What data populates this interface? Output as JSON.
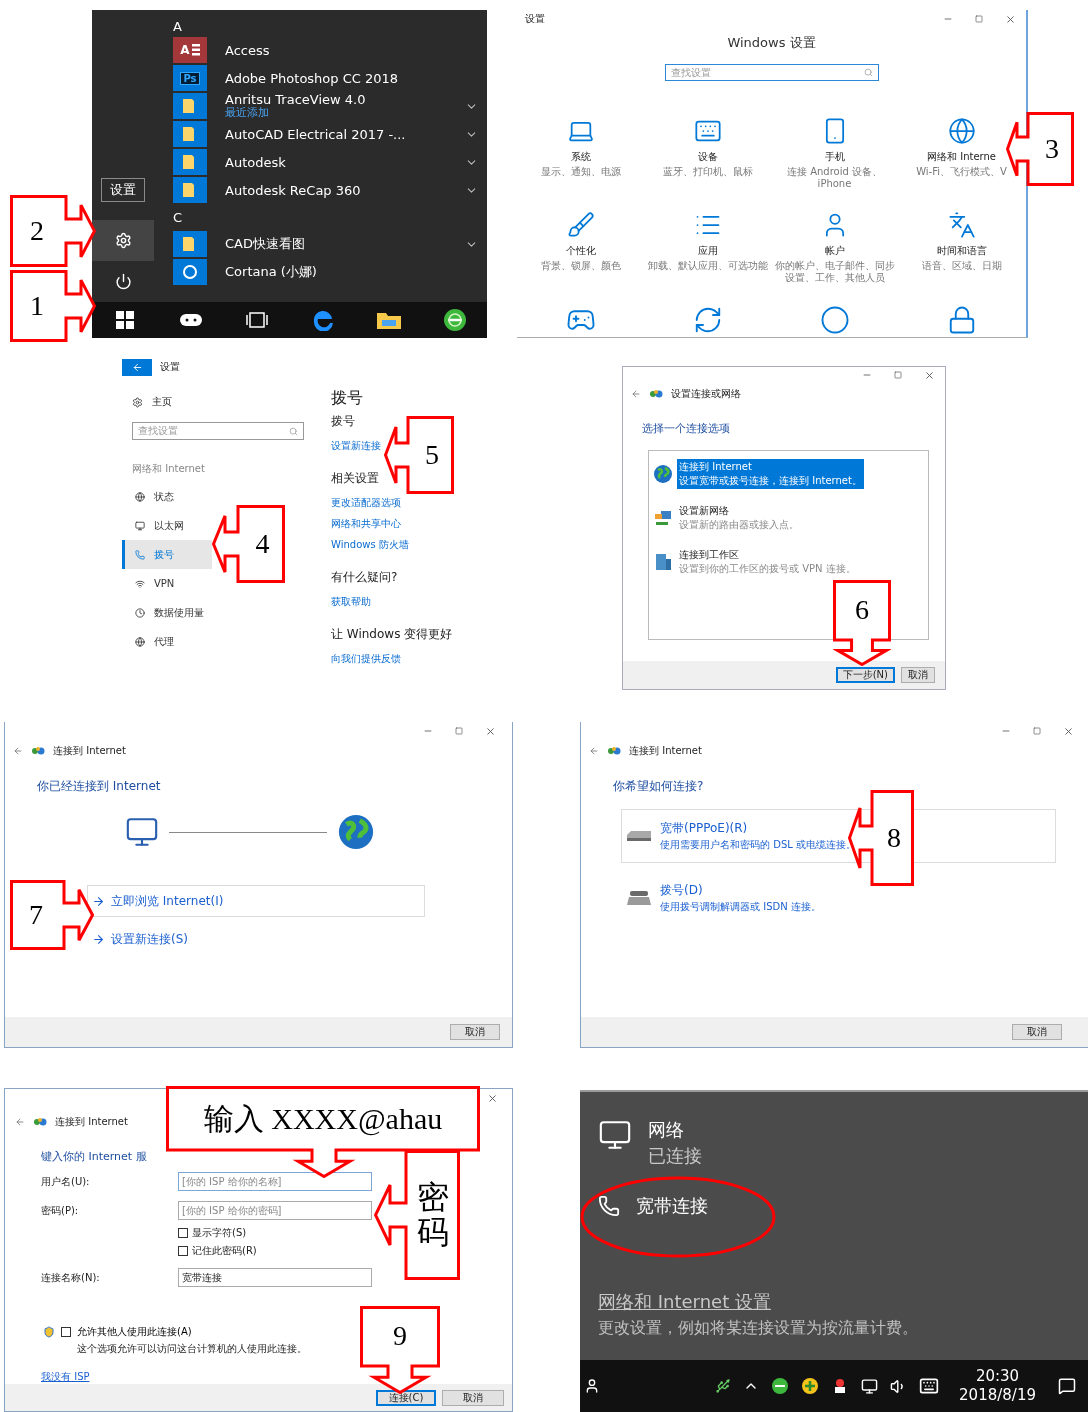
{
  "start_menu": {
    "groups": [
      {
        "letter": "A",
        "apps": [
          {
            "name": "Access",
            "kind": "access",
            "icon_text": "A",
            "expandable": false
          },
          {
            "name": "Adobe Photoshop CC 2018",
            "kind": "photoshop",
            "icon_text": "Ps",
            "expandable": false
          },
          {
            "name": "Anritsu TraceView 4.0",
            "kind": "folder",
            "note": "最近添加",
            "expandable": true
          },
          {
            "name": "AutoCAD Electrical 2017 -...",
            "kind": "folder",
            "expandable": true
          },
          {
            "name": "Autodesk",
            "kind": "folder",
            "expandable": true
          },
          {
            "name": "Autodesk ReCap 360",
            "kind": "folder",
            "expandable": true
          }
        ]
      },
      {
        "letter": "C",
        "apps": [
          {
            "name": "CAD快速看图",
            "kind": "folder",
            "expandable": true
          },
          {
            "name": "Cortana (小娜)",
            "kind": "cortana",
            "expandable": false
          }
        ]
      }
    ],
    "tooltip": "设置",
    "rail": [
      {
        "kind": "settings",
        "selected": true
      },
      {
        "kind": "power",
        "selected": false
      }
    ]
  },
  "windows_settings": {
    "title": "设置",
    "heading": "Windows 设置",
    "search": {
      "placeholder": "查找设置"
    },
    "tiles": [
      {
        "name": "系统",
        "desc": "显示、通知、电源"
      },
      {
        "name": "设备",
        "desc": "蓝牙、打印机、鼠标"
      },
      {
        "name": "手机",
        "desc": "连接 Android 设备、iPhone"
      },
      {
        "name": "网络和 Interne",
        "desc": "Wi-Fi、飞行模式、V"
      },
      {
        "name": "个性化",
        "desc": "背景、锁屏、颜色"
      },
      {
        "name": "应用",
        "desc": "卸载、默认应用、可选功能"
      },
      {
        "name": "帐户",
        "desc": "你的帐户、电子邮件、同步设置、工作、其他人员"
      },
      {
        "name": "时间和语言",
        "desc": "语音、区域、日期"
      }
    ]
  },
  "dialup_settings": {
    "title": "设置",
    "home": "主页",
    "search": {
      "placeholder": "查找设置"
    },
    "section": "网络和 Internet",
    "nav": [
      {
        "label": "状态",
        "selected": false
      },
      {
        "label": "以太网",
        "selected": false
      },
      {
        "label": "拨号",
        "selected": true
      },
      {
        "label": "VPN",
        "selected": false
      },
      {
        "label": "数据使用量",
        "selected": false
      },
      {
        "label": "代理",
        "selected": false
      }
    ],
    "heading": "拨号",
    "groups": [
      {
        "title": "拨号",
        "links": [
          "设置新连接"
        ]
      },
      {
        "title": "相关设置",
        "links": [
          "更改适配器选项",
          "网络和共享中心",
          "Windows 防火墙"
        ]
      },
      {
        "title": "有什么疑问?",
        "links": [
          "获取帮助"
        ]
      },
      {
        "title": "让 Windows 变得更好",
        "links": [
          "向我们提供反馈"
        ]
      }
    ]
  },
  "connection_wizard": {
    "title": "设置连接或网络",
    "heading": "选择一个连接选项",
    "options": [
      {
        "name": "连接到 Internet",
        "desc": "设置宽带或拨号连接，连接到 Internet。",
        "selected": true
      },
      {
        "name": "设置新网络",
        "desc": "设置新的路由器或接入点。",
        "selected": false
      },
      {
        "name": "连接到工作区",
        "desc": "设置到你的工作区的拨号或 VPN 连接。",
        "selected": false
      }
    ],
    "buttons": [
      {
        "label": "下一步(N)",
        "default": true
      },
      {
        "label": "取消",
        "default": false
      }
    ]
  },
  "connected_dialog": {
    "title": "连接到 Internet",
    "heading": "你已经连接到 Internet",
    "actions": [
      {
        "label": "立即浏览 Internet(I)",
        "selected": true
      },
      {
        "label": "设置新连接(S)",
        "selected": false
      }
    ],
    "buttons": [
      "取消"
    ]
  },
  "method_dialog": {
    "title": "连接到 Internet",
    "heading": "你希望如何连接?",
    "options": [
      {
        "name": "宽带(PPPoE)(R)",
        "desc": "使用需要用户名和密码的 DSL 或电缆连接。",
        "selected": true
      },
      {
        "name": "拨号(D)",
        "desc": "使用拨号调制解调器或 ISDN 连接。",
        "selected": false
      }
    ],
    "buttons": [
      "取消"
    ]
  },
  "isp_dialog": {
    "title": "连接到 Internet",
    "heading": "键入你的 Internet 服",
    "fields": [
      {
        "label": "用户名(U):",
        "placeholder": "[你的 ISP 给你的名称]"
      },
      {
        "label": "密码(P):",
        "placeholder": "[你的 ISP 给你的密码]"
      }
    ],
    "checks": [
      {
        "label": "显示字符(S)",
        "checked": false
      },
      {
        "label": "记住此密码(R)",
        "checked": false
      }
    ],
    "name_field": {
      "label": "连接名称(N):",
      "value": "宽带连接"
    },
    "allow": {
      "label": "允许其他人使用此连接(A)",
      "checked": false,
      "desc": "这个选项允许可以访问这台计算机的人使用此连接。"
    },
    "link": "我没有 ISP",
    "buttons": [
      {
        "label": "连接(C)",
        "default": true
      },
      {
        "label": "取消",
        "default": false
      }
    ]
  },
  "network_flyout": {
    "network": {
      "name": "网络",
      "status": "已连接"
    },
    "connection": {
      "name": "宽带连接"
    },
    "settings_link": "网络和 Internet 设置",
    "settings_desc": "更改设置，例如将某连接设置为按流量计费。",
    "clock": {
      "time": "20:30",
      "date": "2018/8/19"
    }
  },
  "callouts": [
    {
      "label": "3"
    },
    {
      "label": "2"
    },
    {
      "label": "1"
    },
    {
      "label": "5"
    },
    {
      "label": "4"
    },
    {
      "label": "6"
    },
    {
      "label": "8"
    },
    {
      "label": "7"
    },
    {
      "label": "输入 XXXX@ahau"
    },
    {
      "label": "密码"
    },
    {
      "label": "9"
    }
  ]
}
